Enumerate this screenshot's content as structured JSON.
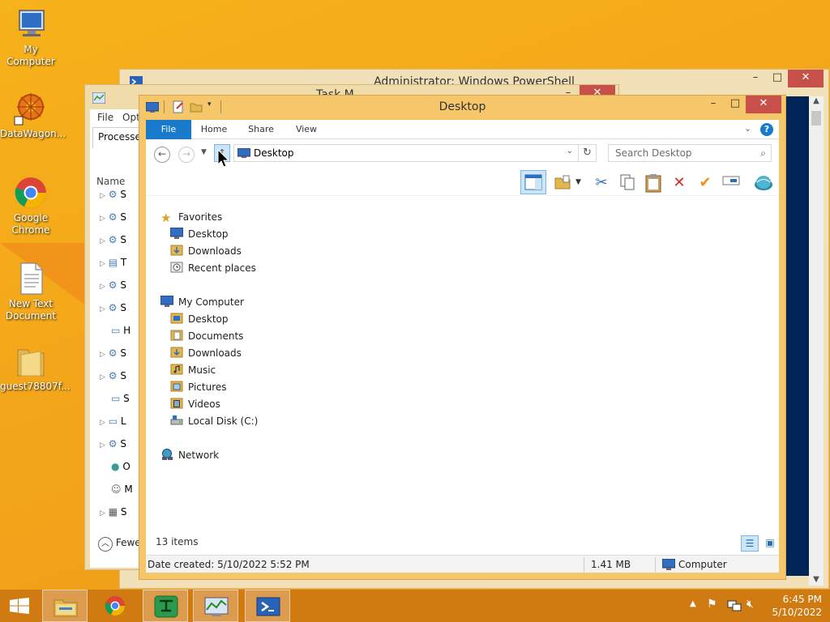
{
  "desktop": {
    "icons": [
      {
        "label": "My Computer"
      },
      {
        "label": "DataWagon..."
      },
      {
        "label": "Google Chrome"
      },
      {
        "label": "New Text Document"
      },
      {
        "label": "guest78807f..."
      }
    ]
  },
  "powershell": {
    "title": "Administrator: Windows PowerShell"
  },
  "taskmanager": {
    "title": "Task M",
    "menu": [
      "File",
      "Opt"
    ],
    "tab": "Processes",
    "column": "Name",
    "rows": [
      "S",
      "S",
      "S",
      "T",
      "S",
      "S",
      "H",
      "S",
      "S",
      "S",
      "L",
      "S",
      "O",
      "M",
      "S"
    ],
    "fewer": "Fewe"
  },
  "explorer": {
    "title": "Desktop",
    "tabs": {
      "file": "File",
      "home": "Home",
      "share": "Share",
      "view": "View"
    },
    "address": "Desktop",
    "search_placeholder": "Search Desktop",
    "nav": {
      "favorites": "Favorites",
      "fav_desktop": "Desktop",
      "fav_downloads": "Downloads",
      "fav_recent": "Recent places",
      "mycomputer": "My Computer",
      "mc_desktop": "Desktop",
      "mc_documents": "Documents",
      "mc_downloads": "Downloads",
      "mc_music": "Music",
      "mc_pictures": "Pictures",
      "mc_videos": "Videos",
      "mc_local": "Local Disk (C:)",
      "network": "Network"
    },
    "item_count": "13 items",
    "status": {
      "date_created": "Date created: 5/10/2022 5:52 PM",
      "size": "1.41 MB",
      "location": "Computer"
    }
  },
  "taskbar": {
    "time": "6:45 PM",
    "date": "5/10/2022"
  },
  "colors": {
    "accent": "#1979ca",
    "wallpaper": "#f4a71a",
    "taskbar": "#d07a12",
    "explorer_frame": "#f5c76a"
  }
}
